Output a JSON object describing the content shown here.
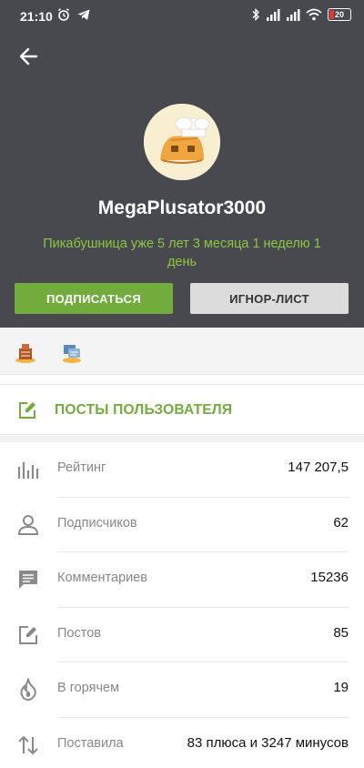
{
  "status_bar": {
    "time": "21:10",
    "battery": "20",
    "icons": [
      "alarm-icon",
      "telegram-icon",
      "bluetooth-icon",
      "signal-icon",
      "signal-icon",
      "wifi-icon",
      "battery-icon"
    ]
  },
  "profile": {
    "username": "MegaPlusator3000",
    "tenure": "Пикабушница уже 5 лет 3 месяца 1 неделю 1 день",
    "subscribe_label": "ПОДПИСАТЬСЯ",
    "ignore_label": "ИГНОР-ЛИСТ"
  },
  "awards": [
    "award-badge-icon",
    "award-badge-icon"
  ],
  "posts_link": {
    "label": "ПОСТЫ ПОЛЬЗОВАТЕЛЯ"
  },
  "stats": [
    {
      "icon": "bar-chart-icon",
      "label": "Рейтинг",
      "value": "147 207,5"
    },
    {
      "icon": "person-icon",
      "label": "Подписчиков",
      "value": "62"
    },
    {
      "icon": "comment-icon",
      "label": "Комментариев",
      "value": "15236"
    },
    {
      "icon": "edit-icon",
      "label": "Постов",
      "value": "85"
    },
    {
      "icon": "fire-icon",
      "label": "В горячем",
      "value": "19"
    },
    {
      "icon": "up-down-arrows-icon",
      "label": "Поставила",
      "value": "83 плюса и 3247 минусов"
    }
  ],
  "colors": {
    "header_bg": "#47494f",
    "accent_green": "#72ac3c",
    "tenure_green": "#8dc63f"
  }
}
